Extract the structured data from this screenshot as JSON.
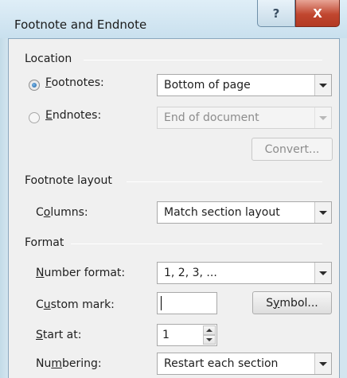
{
  "window": {
    "title": "Footnote and Endnote",
    "help_glyph": "?",
    "close_glyph": "X"
  },
  "location": {
    "heading": "Location",
    "footnotes": {
      "label_underlined": "F",
      "label_rest": "ootnotes:",
      "selected": true,
      "value": "Bottom of page"
    },
    "endnotes": {
      "label_underlined": "E",
      "label_rest": "ndnotes:",
      "selected": false,
      "value": "End of document",
      "enabled": false
    },
    "convert_button": "Convert..."
  },
  "footnote_layout": {
    "heading": "Footnote layout",
    "columns": {
      "label_pre": "C",
      "label_underlined": "o",
      "label_rest": "lumns:",
      "value": "Match section layout"
    }
  },
  "format": {
    "heading": "Format",
    "number_format": {
      "label_underlined": "N",
      "label_rest": "umber format:",
      "value": "1, 2, 3, ..."
    },
    "custom_mark": {
      "label_pre": "C",
      "label_underlined": "u",
      "label_rest": "stom mark:",
      "value": ""
    },
    "symbol_button": {
      "pre": "S",
      "underlined": "y",
      "rest": "mbol..."
    },
    "start_at": {
      "label_underlined": "S",
      "label_rest": "tart at:",
      "value": "1"
    },
    "numbering": {
      "label_pre": "Nu",
      "label_underlined": "m",
      "label_rest": "bering:",
      "value": "Restart each section"
    }
  },
  "icons": {
    "help": "question-icon",
    "close": "close-icon",
    "dropdown": "chevron-down-icon",
    "spin_up": "spin-up-icon",
    "spin_down": "spin-down-icon"
  },
  "colors": {
    "window_frame": "#c3dbe8",
    "dialog_bg": "#f0f0f0",
    "close_button": "#c0462f",
    "radio_selected": "#1e5e9e",
    "disabled_text": "#8c8c8c"
  }
}
